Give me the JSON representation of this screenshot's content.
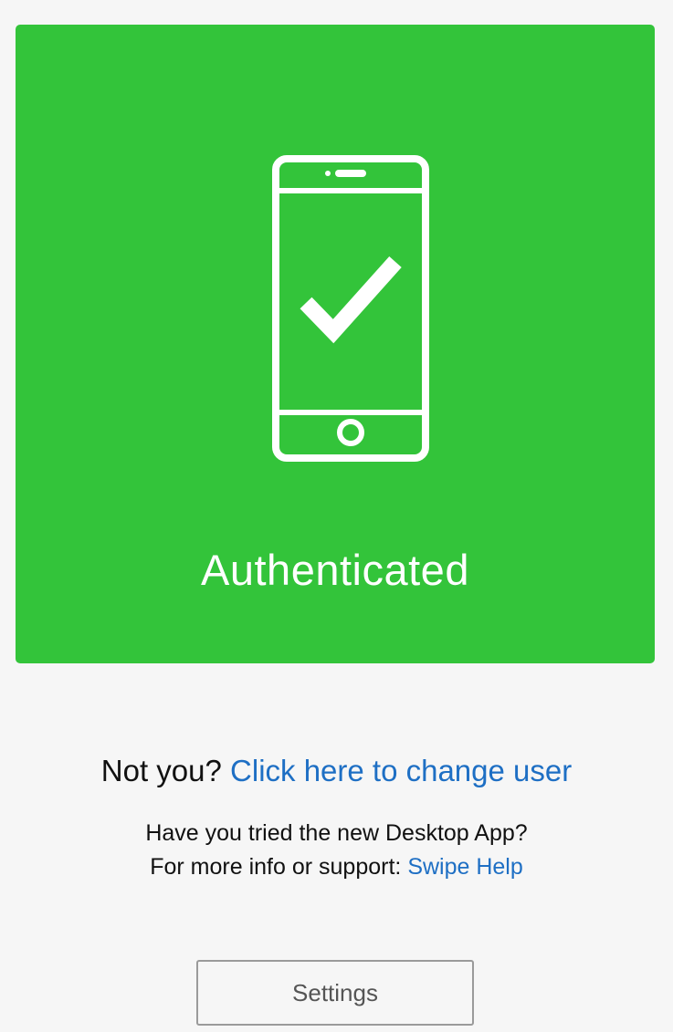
{
  "colors": {
    "card_background": "#33c43a",
    "page_background": "#f6f6f6",
    "link": "#1e6fc4",
    "text": "#111111",
    "button_border": "#9a9a9a"
  },
  "auth_card": {
    "icon": "phone-checkmark-icon",
    "status": "Authenticated"
  },
  "user": {
    "prompt": "Not you?",
    "change_user_link": "Click here to change user"
  },
  "info": {
    "desktop_app": "Have you tried the new Desktop App?",
    "support_prefix": "For more info or support:",
    "help_link": "Swipe Help"
  },
  "settings": {
    "label": "Settings"
  }
}
